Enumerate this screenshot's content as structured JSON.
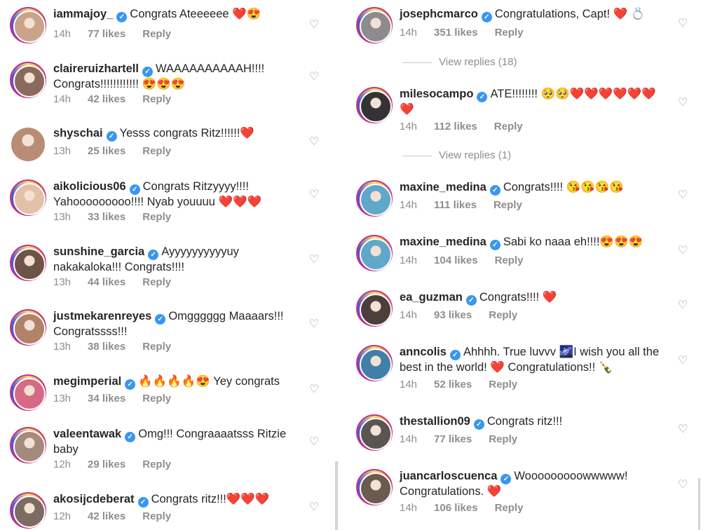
{
  "left_comments": [
    {
      "username": "iammajoy_",
      "text": "Congrats Ateeeeee ❤️😍",
      "time": "14h",
      "likes": "77 likes",
      "reply": "Reply",
      "avatar_color": "#c9a38a"
    },
    {
      "username": "claireruizhartell",
      "text": "WAAAAAAAAAAH!!!! Congrats!!!!!!!!!!!! 😍😍😍",
      "time": "14h",
      "likes": "42 likes",
      "reply": "Reply",
      "avatar_color": "#8a6a5c"
    },
    {
      "username": "shyschai",
      "text": "Yesss congrats Ritz!!!!!!❤️",
      "time": "13h",
      "likes": "25 likes",
      "reply": "Reply",
      "avatar_color": "#b88d74"
    },
    {
      "username": "aikolicious06",
      "text": "Congrats Ritzyyyy!!!! Yahooooooooo!!!! Nyab youuuu ❤️❤️❤️",
      "time": "13h",
      "likes": "33 likes",
      "reply": "Reply",
      "avatar_color": "#e3c1a9"
    },
    {
      "username": "sunshine_garcia",
      "text": "Ayyyyyyyyyyuy nakakaloka!!! Congrats!!!!",
      "time": "13h",
      "likes": "44 likes",
      "reply": "Reply",
      "avatar_color": "#6d5446"
    },
    {
      "username": "justmekarenreyes",
      "text": "Omgggggg Maaaars!!! Congratssss!!!",
      "time": "13h",
      "likes": "38 likes",
      "reply": "Reply",
      "avatar_color": "#b08269"
    },
    {
      "username": "megimperial",
      "text": "🔥🔥🔥🔥😍 Yey congrats",
      "time": "13h",
      "likes": "34 likes",
      "reply": "Reply",
      "avatar_color": "#d46a86"
    },
    {
      "username": "valeentawak",
      "text": "Omg!!! Congraaaatsss Ritzie baby",
      "time": "12h",
      "likes": "29 likes",
      "reply": "Reply",
      "avatar_color": "#a48a7a"
    },
    {
      "username": "akosijcdeberat",
      "text": "Congrats ritz!!!❤️❤️❤️",
      "time": "12h",
      "likes": "42 likes",
      "reply": "Reply",
      "avatar_color": "#7d6a63"
    }
  ],
  "right_comments": [
    {
      "username": "josephcmarco",
      "text": "Congratulations, Capt! ❤️ 💍",
      "time": "14h",
      "likes": "351 likes",
      "reply": "Reply",
      "avatar_color": "#8c8c8c"
    },
    {
      "username": "milesocampo",
      "text": "ATE!!!!!!!! 🥺🥺❤️❤️❤️❤️❤️❤️ ❤️",
      "time": "14h",
      "likes": "112 likes",
      "reply": "Reply",
      "avatar_color": "#333333"
    },
    {
      "username": "maxine_medina",
      "text": "Congrats!!!! 😘😘😘😘",
      "time": "14h",
      "likes": "111 likes",
      "reply": "Reply",
      "avatar_color": "#5fa8c9"
    },
    {
      "username": "maxine_medina",
      "text": "Sabi ko naaa eh!!!!😍😍😍",
      "time": "14h",
      "likes": "104 likes",
      "reply": "Reply",
      "avatar_color": "#5fa8c9"
    },
    {
      "username": "ea_guzman",
      "text": "Congrats!!!! ❤️",
      "time": "14h",
      "likes": "93 likes",
      "reply": "Reply",
      "avatar_color": "#4a3f3a"
    },
    {
      "username": "anncolis",
      "text": "Ahhhh. True luvvv 🌌I wish you all the best in the world! ❤️ Congratulations!! 🍾",
      "time": "14h",
      "likes": "52 likes",
      "reply": "Reply",
      "avatar_color": "#3f7fa8"
    },
    {
      "username": "thestallion09",
      "text": "Congrats ritz!!!",
      "time": "14h",
      "likes": "77 likes",
      "reply": "Reply",
      "avatar_color": "#5a5550"
    },
    {
      "username": "juancarloscuenca",
      "text": "Wooooooooowwwww! Congratulations. ❤️",
      "time": "14h",
      "likes": "106 likes",
      "reply": "Reply",
      "avatar_color": "#6b5a4e"
    }
  ],
  "view_replies": [
    {
      "label": "View replies (18)"
    },
    {
      "label": "View replies (1)"
    }
  ],
  "icons": {
    "verified": "verified-badge-icon",
    "like": "heart-outline-icon"
  },
  "colors": {
    "accent": "#3897f0",
    "text": "#262626",
    "meta": "#8e8e8e"
  }
}
